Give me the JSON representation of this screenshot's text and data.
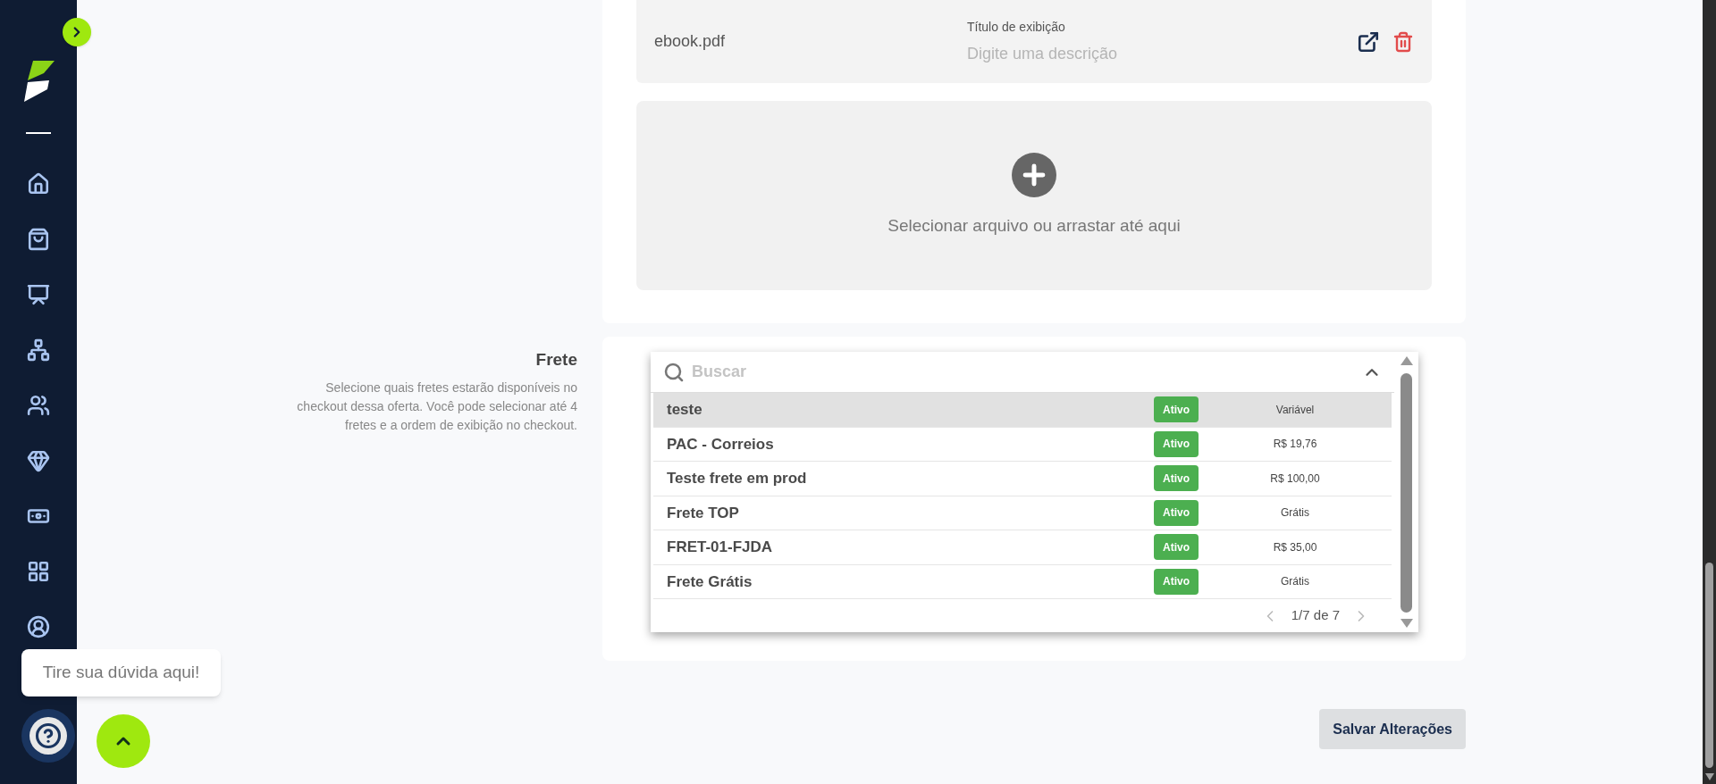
{
  "file": {
    "name": "ebook.pdf",
    "title_label": "Título de exibição",
    "title_placeholder": "Digite uma descrição"
  },
  "upload": {
    "text": "Selecionar arquivo ou arrastar até aqui"
  },
  "frete": {
    "title": "Frete",
    "description": "Selecione quais fretes estarão disponíveis no checkout dessa oferta. Você pode selecionar até 4 fretes e a ordem de exibição no checkout.",
    "dropdown": {
      "search_placeholder": "Buscar",
      "pagination": "1/7 de 7",
      "options": [
        {
          "name": "teste",
          "status": "Ativo",
          "price": "Variável",
          "selected": true
        },
        {
          "name": "PAC - Correios",
          "status": "Ativo",
          "price": "R$ 19,76",
          "selected": false
        },
        {
          "name": "Teste frete em prod",
          "status": "Ativo",
          "price": "R$ 100,00",
          "selected": false
        },
        {
          "name": "Frete TOP",
          "status": "Ativo",
          "price": "Grátis",
          "selected": false
        },
        {
          "name": "FRET-01-FJDA",
          "status": "Ativo",
          "price": "R$ 35,00",
          "selected": false
        },
        {
          "name": "Frete Grátis",
          "status": "Ativo",
          "price": "Grátis",
          "selected": false
        }
      ]
    }
  },
  "save_button": "Salvar Alterações",
  "help": {
    "tooltip": "Tire sua dúvida aqui!"
  }
}
